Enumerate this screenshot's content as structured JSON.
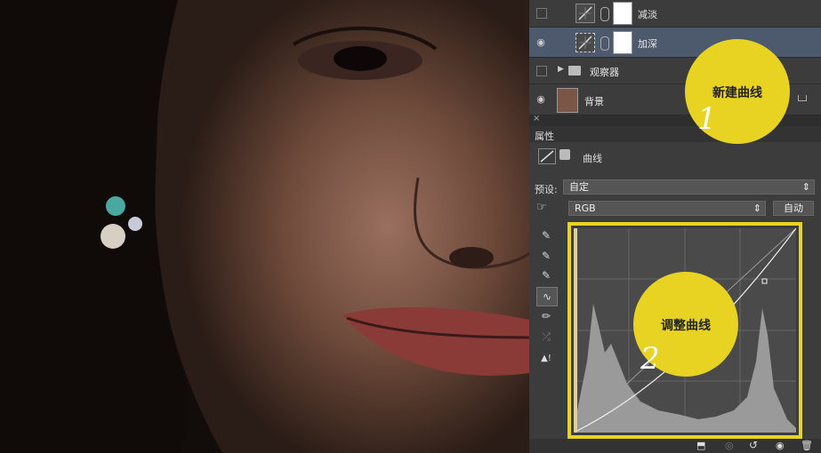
{
  "layers": [
    {
      "name": "减淡",
      "visible": false
    },
    {
      "name": "加深",
      "visible": true,
      "selected": true
    },
    {
      "name": "观察器",
      "visible": false,
      "group": true
    },
    {
      "name": "背景",
      "visible": true,
      "locked": true
    }
  ],
  "properties": {
    "tab_label": "属性",
    "adjustment_name": "曲线",
    "preset_label": "预设:",
    "preset_value": "自定",
    "channel_value": "RGB",
    "auto_button": "自动"
  },
  "callouts": [
    {
      "text": "新建曲线",
      "number": "1"
    },
    {
      "text": "调整曲线",
      "number": "2"
    }
  ],
  "colors": {
    "panel_bg": "#3c3c3c",
    "accent_yellow": "#e8d323",
    "selected_row": "#4d5a6e"
  },
  "icons": [
    "eye-icon",
    "folder-icon",
    "chain-icon",
    "curves-icon",
    "eyedropper-icon",
    "pencil-icon",
    "smooth-icon",
    "warning-icon",
    "clip-icon",
    "reset-icon",
    "trash-icon"
  ]
}
